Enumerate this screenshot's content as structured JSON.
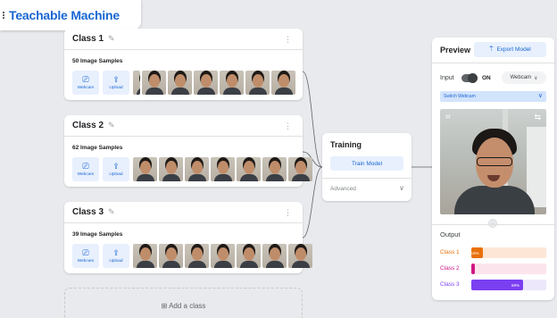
{
  "app": {
    "title": "Teachable Machine"
  },
  "classes": [
    {
      "name": "Class 1",
      "samples": "50 Image Samples",
      "webcam": "Webcam",
      "upload": "Upload"
    },
    {
      "name": "Class 2",
      "samples": "62 Image Samples",
      "webcam": "Webcam",
      "upload": "Upload"
    },
    {
      "name": "Class 3",
      "samples": "39 Image Samples",
      "webcam": "Webcam",
      "upload": "Upload"
    }
  ],
  "add_class": {
    "label": "⊞ Add a class"
  },
  "training": {
    "title": "Training",
    "train_button": "Train Model",
    "advanced": "Advanced"
  },
  "preview": {
    "title": "Preview",
    "export_button": "Export Model",
    "input_label": "Input",
    "toggle_state": "ON",
    "source_select": "Webcam",
    "switch_webcam": "Switch Webcam",
    "output_title": "Output",
    "outputs": [
      {
        "name": "Class 1",
        "percent": "15%",
        "value": 0.15,
        "color": "#e8710a",
        "track": "#fde6d6"
      },
      {
        "name": "Class 2",
        "percent": "",
        "value": 0.05,
        "color": "#d01884",
        "track": "#fce4ec"
      },
      {
        "name": "Class 3",
        "percent": "69%",
        "value": 0.69,
        "color": "#7b3ff2",
        "track": "#ece7fb"
      }
    ]
  },
  "colors": {
    "accent": "#1967d2",
    "accent_bg": "#e8f0fe",
    "canvas": "#e8eaed"
  },
  "icons": {
    "pencil": "✎",
    "kebab": "⋮",
    "webcam": "⎚",
    "upload": "⇪",
    "chevron": "∨",
    "export": "⍑",
    "crop": "⌗",
    "flip": "⇆",
    "scroll": "⌄"
  }
}
